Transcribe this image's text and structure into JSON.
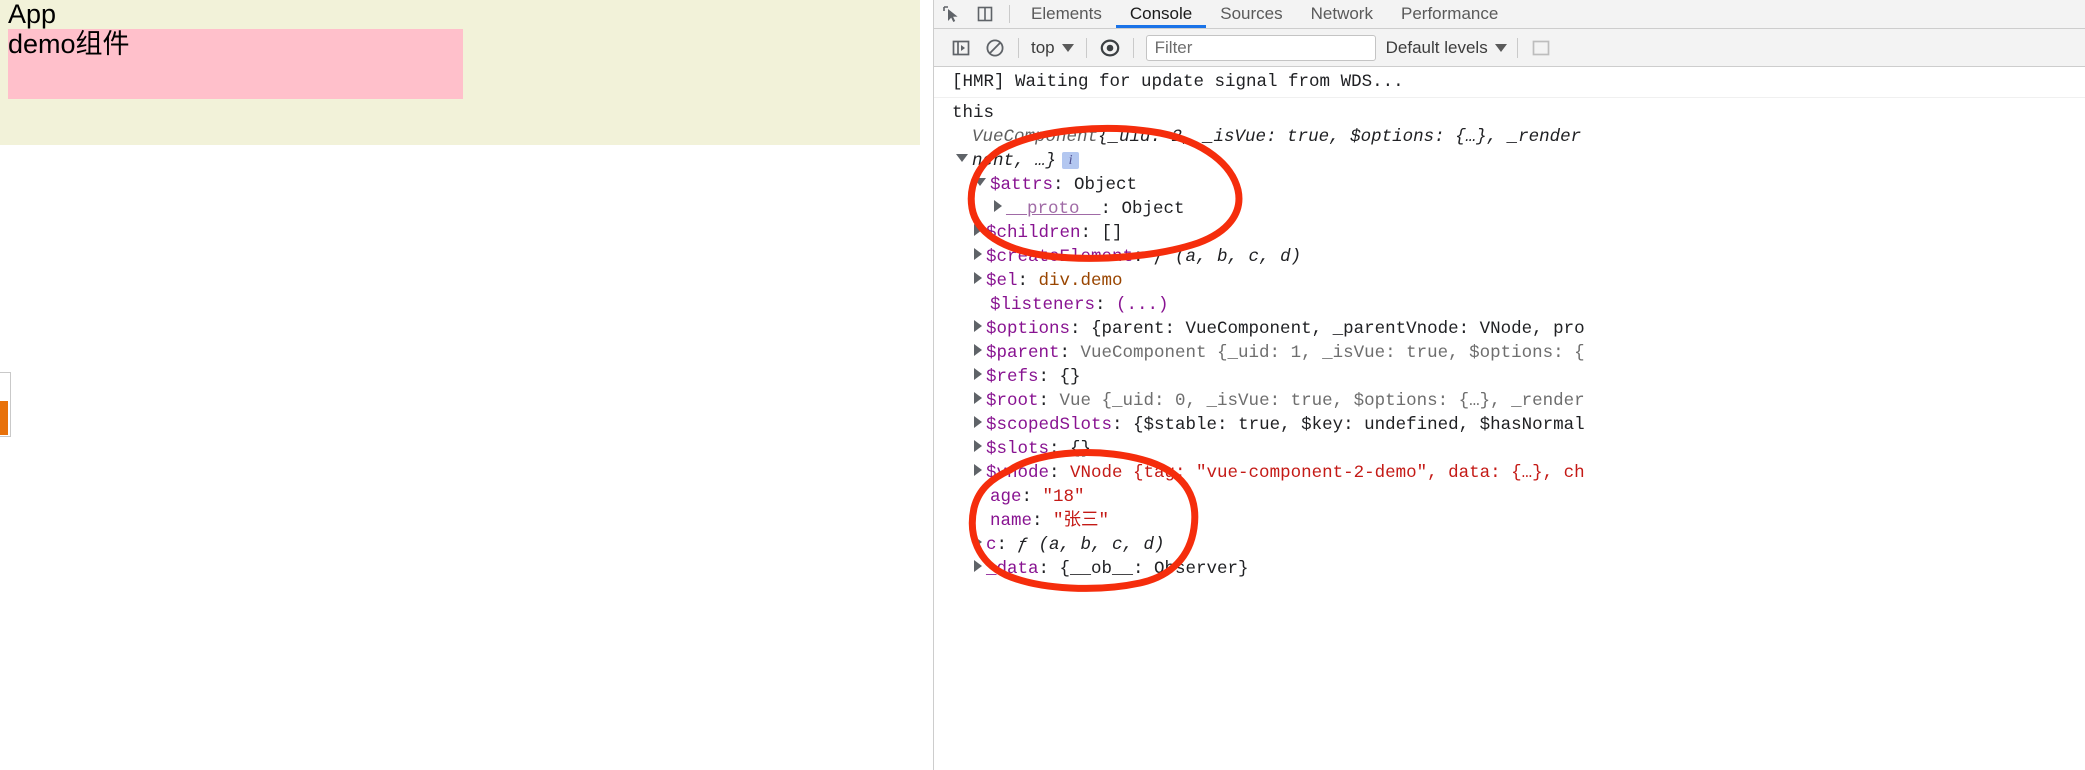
{
  "page": {
    "app_title": "App",
    "demo_text": "demo组件",
    "bg_color": "#f2f2d9",
    "demo_bg_color": "#ffc0cb"
  },
  "devtools": {
    "tabs": [
      {
        "label": "Elements",
        "active": false
      },
      {
        "label": "Console",
        "active": true
      },
      {
        "label": "Sources",
        "active": false
      },
      {
        "label": "Network",
        "active": false
      },
      {
        "label": "Performance",
        "active": false
      }
    ],
    "tab_icons": [
      "inspect-element-icon",
      "device-toolbar-icon"
    ],
    "active_tab_underline_color": "#1a73e8",
    "toolbar": {
      "sidebar_toggle_icon": "console-sidebar-icon",
      "clear_icon": "clear-console-icon",
      "context_selector": "top",
      "eye_icon": "live-expression-icon",
      "filter_placeholder": "Filter",
      "filter_value": "",
      "levels_label": "Default levels"
    }
  },
  "console": {
    "messages": [
      {
        "text": "[HMR] Waiting for update signal from WDS..."
      },
      {
        "text": "this"
      }
    ],
    "object_header": {
      "class_name": "VueComponent",
      "preview_line1": "{_uid: 2, _isVue: true, $options: {…}, _render",
      "preview_line2": "nent, …}",
      "uid": "2",
      "is_vue": "true",
      "info_badge": "i"
    },
    "properties": [
      {
        "name": "$attrs",
        "sep": ": ",
        "value": "Object",
        "expanded": true,
        "indent": 1,
        "kind": "object"
      },
      {
        "name": "__proto__",
        "sep": ": ",
        "value": "Object",
        "expanded": false,
        "indent": 2,
        "kind": "proto"
      },
      {
        "name": "$children",
        "sep": ": ",
        "value": "[]",
        "expanded": false,
        "indent": 1,
        "kind": "plain"
      },
      {
        "name": "$createElement",
        "sep": ": ",
        "value": "ƒ (a, b, c, d)",
        "expanded": false,
        "indent": 1,
        "kind": "function"
      },
      {
        "name": "$el",
        "sep": ": ",
        "value": "div.demo",
        "expanded": false,
        "indent": 1,
        "kind": "element"
      },
      {
        "name": "$listeners",
        "sep": ": ",
        "value": "(...)",
        "expanded": null,
        "indent": 1,
        "kind": "getter"
      },
      {
        "name": "$options",
        "sep": ": ",
        "value": "{parent: VueComponent, _parentVnode: VNode, pro",
        "expanded": false,
        "indent": 1,
        "kind": "preview"
      },
      {
        "name": "$parent",
        "sep": ": ",
        "value": "VueComponent {_uid: 1, _isVue: true, $options: {",
        "expanded": false,
        "indent": 1,
        "kind": "instance"
      },
      {
        "name": "$refs",
        "sep": ": ",
        "value": "{}",
        "expanded": false,
        "indent": 1,
        "kind": "plain"
      },
      {
        "name": "$root",
        "sep": ": ",
        "value": "Vue {_uid: 0, _isVue: true, $options: {…}, _render",
        "expanded": false,
        "indent": 1,
        "kind": "instance"
      },
      {
        "name": "$scopedSlots",
        "sep": ": ",
        "value": "{$stable: true, $key: undefined, $hasNormal",
        "expanded": false,
        "indent": 1,
        "kind": "preview"
      },
      {
        "name": "$slots",
        "sep": ": ",
        "value": "{}",
        "expanded": false,
        "indent": 1,
        "kind": "plain"
      },
      {
        "name": "$vnode",
        "sep": ": ",
        "value": "VNode {tag: \"vue-component-2-demo\", data: {…}, ch",
        "expanded": false,
        "indent": 1,
        "kind": "instance"
      },
      {
        "name": "age",
        "sep": ": ",
        "value": "\"18\"",
        "expanded": null,
        "indent": 1,
        "kind": "string"
      },
      {
        "name": "name",
        "sep": ": ",
        "value": "\"张三\"",
        "expanded": null,
        "indent": 1,
        "kind": "string"
      },
      {
        "name": "c",
        "sep": ": ",
        "value": "ƒ (a, b, c, d)",
        "expanded": false,
        "indent": 1,
        "kind": "function"
      },
      {
        "name": "_data",
        "sep": ": ",
        "value": "{__ob__: Observer}",
        "expanded": false,
        "indent": 1,
        "kind": "preview"
      }
    ]
  },
  "annotations": {
    "color": "#f52d0c",
    "shapes": [
      "circle-around-attrs-section",
      "circle-around-vnode-age-name"
    ]
  }
}
